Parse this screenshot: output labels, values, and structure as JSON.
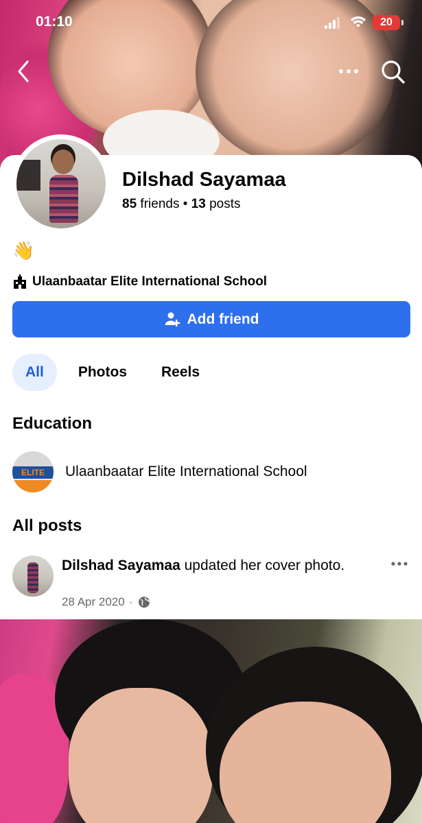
{
  "status_bar": {
    "time": "01:10",
    "battery": "20"
  },
  "profile": {
    "name": "Dilshad Sayamaa",
    "friends_count": "85",
    "friends_label": "friends",
    "separator": "•",
    "posts_count": "13",
    "posts_label": "posts",
    "bio_emoji": "👋",
    "school": "Ulaanbaatar Elite International School"
  },
  "actions": {
    "add_friend": "Add friend"
  },
  "tabs": [
    {
      "label": "All",
      "active": true
    },
    {
      "label": "Photos",
      "active": false
    },
    {
      "label": "Reels",
      "active": false
    }
  ],
  "education": {
    "title": "Education",
    "school_name": "Ulaanbaatar Elite International School",
    "logo_text": "ELITE"
  },
  "posts": {
    "title": "All posts",
    "items": [
      {
        "author": "Dilshad Sayamaa",
        "action": "updated her cover photo.",
        "date": "28 Apr 2020",
        "dot": "·"
      }
    ]
  },
  "icons": {
    "back": "chevron-left-icon",
    "more": "more-horizontal-icon",
    "search": "search-icon",
    "school": "school-building-icon",
    "add_friend": "add-person-icon",
    "audience": "globe-icon"
  },
  "colors": {
    "primary": "#2e6fed",
    "tab_active_bg": "#e6efff",
    "tab_active_text": "#1f5fd6",
    "battery": "#e53935",
    "meta_text": "#65676b"
  }
}
